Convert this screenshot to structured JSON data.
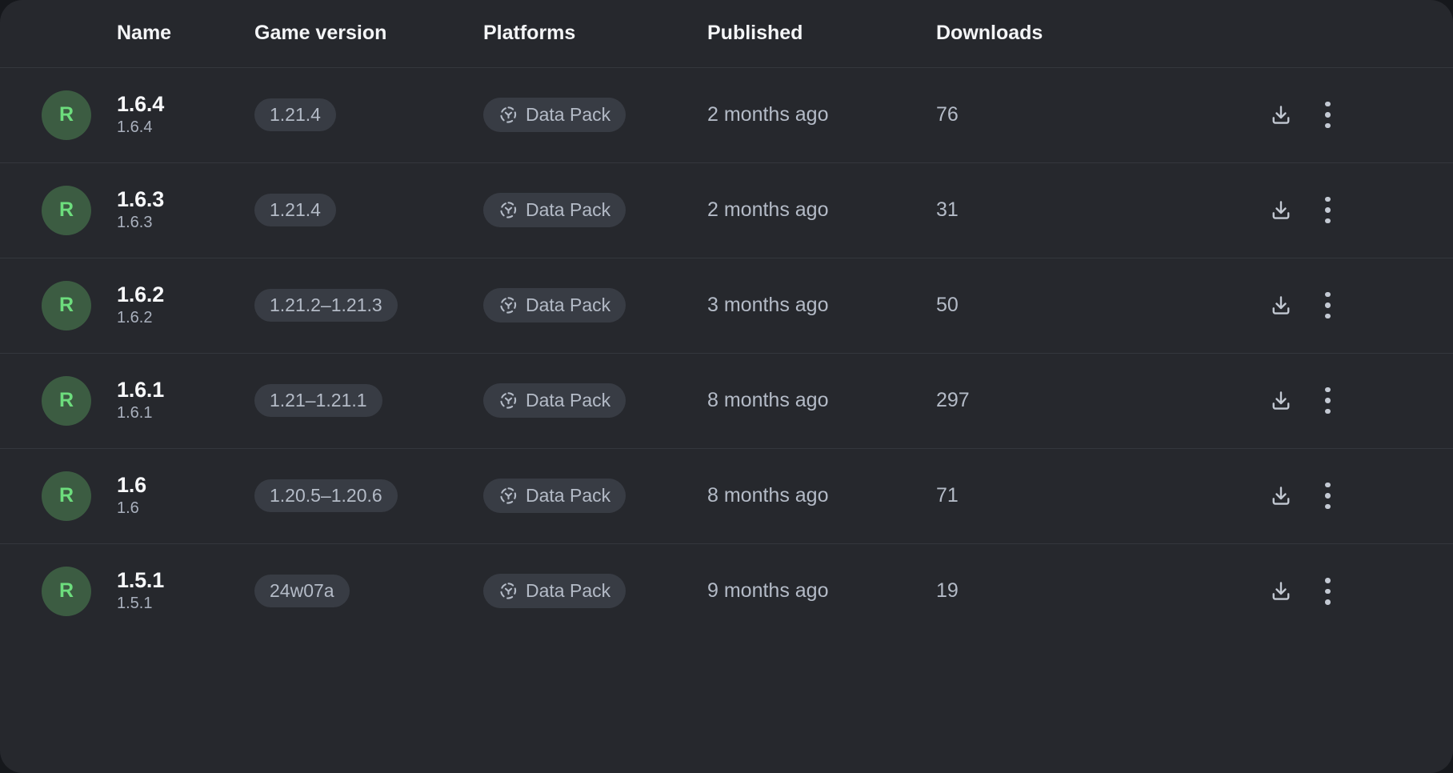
{
  "table": {
    "columns": [
      {
        "key": "avatar",
        "label": ""
      },
      {
        "key": "name",
        "label": "Name"
      },
      {
        "key": "gamever",
        "label": "Game version"
      },
      {
        "key": "platform",
        "label": "Platforms"
      },
      {
        "key": "pub",
        "label": "Published"
      },
      {
        "key": "dl",
        "label": "Downloads"
      },
      {
        "key": "actions",
        "label": ""
      }
    ],
    "rows": [
      {
        "avatar_letter": "R",
        "name": "1.6.4",
        "version_number": "1.6.4",
        "game_version": "1.21.4",
        "platform": "Data Pack",
        "platform_icon": "data-pack-icon",
        "published": "2 months ago",
        "downloads": "76",
        "download_icon": "download-icon",
        "menu_icon": "more-vertical-icon"
      },
      {
        "avatar_letter": "R",
        "name": "1.6.3",
        "version_number": "1.6.3",
        "game_version": "1.21.4",
        "platform": "Data Pack",
        "platform_icon": "data-pack-icon",
        "published": "2 months ago",
        "downloads": "31",
        "download_icon": "download-icon",
        "menu_icon": "more-vertical-icon"
      },
      {
        "avatar_letter": "R",
        "name": "1.6.2",
        "version_number": "1.6.2",
        "game_version": "1.21.2–1.21.3",
        "platform": "Data Pack",
        "platform_icon": "data-pack-icon",
        "published": "3 months ago",
        "downloads": "50",
        "download_icon": "download-icon",
        "menu_icon": "more-vertical-icon"
      },
      {
        "avatar_letter": "R",
        "name": "1.6.1",
        "version_number": "1.6.1",
        "game_version": "1.21–1.21.1",
        "platform": "Data Pack",
        "platform_icon": "data-pack-icon",
        "published": "8 months ago",
        "downloads": "297",
        "download_icon": "download-icon",
        "menu_icon": "more-vertical-icon"
      },
      {
        "avatar_letter": "R",
        "name": "1.6",
        "version_number": "1.6",
        "game_version": "1.20.5–1.20.6",
        "platform": "Data Pack",
        "platform_icon": "data-pack-icon",
        "published": "8 months ago",
        "downloads": "71",
        "download_icon": "download-icon",
        "menu_icon": "more-vertical-icon"
      },
      {
        "avatar_letter": "R",
        "name": "1.5.1",
        "version_number": "1.5.1",
        "game_version": "24w07a",
        "platform": "Data Pack",
        "platform_icon": "data-pack-icon",
        "published": "9 months ago",
        "downloads": "19",
        "download_icon": "download-icon",
        "menu_icon": "more-vertical-icon"
      }
    ]
  },
  "colors": {
    "page_background": "#16181c",
    "panel_background": "#26282d",
    "row_divider": "#34373d",
    "pill_background": "#383c44",
    "pill_text": "#b4bbc7",
    "heading_text": "#f4f5f7",
    "primary_text": "#f7f8fa",
    "secondary_text": "#a9b0bd",
    "avatar_background": "#3c5c42",
    "avatar_letter": "#6ddd7d",
    "icon": "#c3c9d3"
  }
}
